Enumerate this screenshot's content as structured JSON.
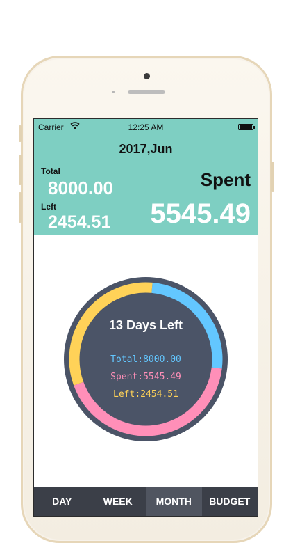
{
  "status_bar": {
    "carrier": "Carrier",
    "time": "12:25 AM"
  },
  "header": {
    "month_title": "2017,Jun",
    "total_label": "Total",
    "total_value": "8000.00",
    "left_label": "Left",
    "left_value": "2454.51",
    "spent_label": "Spent",
    "spent_value": "5545.49"
  },
  "gauge": {
    "days_left": "13 Days Left",
    "total_line": "Total:8000.00",
    "spent_line": "Spent:5545.49",
    "left_line": "Left:2454.51",
    "colors": {
      "background": "#4b5467",
      "total": "#63c7ff",
      "spent": "#ff8fb8",
      "left": "#ffd258"
    }
  },
  "tabs": [
    {
      "label": "DAY",
      "active": false
    },
    {
      "label": "WEEK",
      "active": false
    },
    {
      "label": "MONTH",
      "active": true
    },
    {
      "label": "BUDGET",
      "active": false
    }
  ],
  "colors": {
    "header_bg": "#7ecfc2",
    "tabbar_bg": "#3b3f48",
    "tab_active_bg": "#505560"
  }
}
